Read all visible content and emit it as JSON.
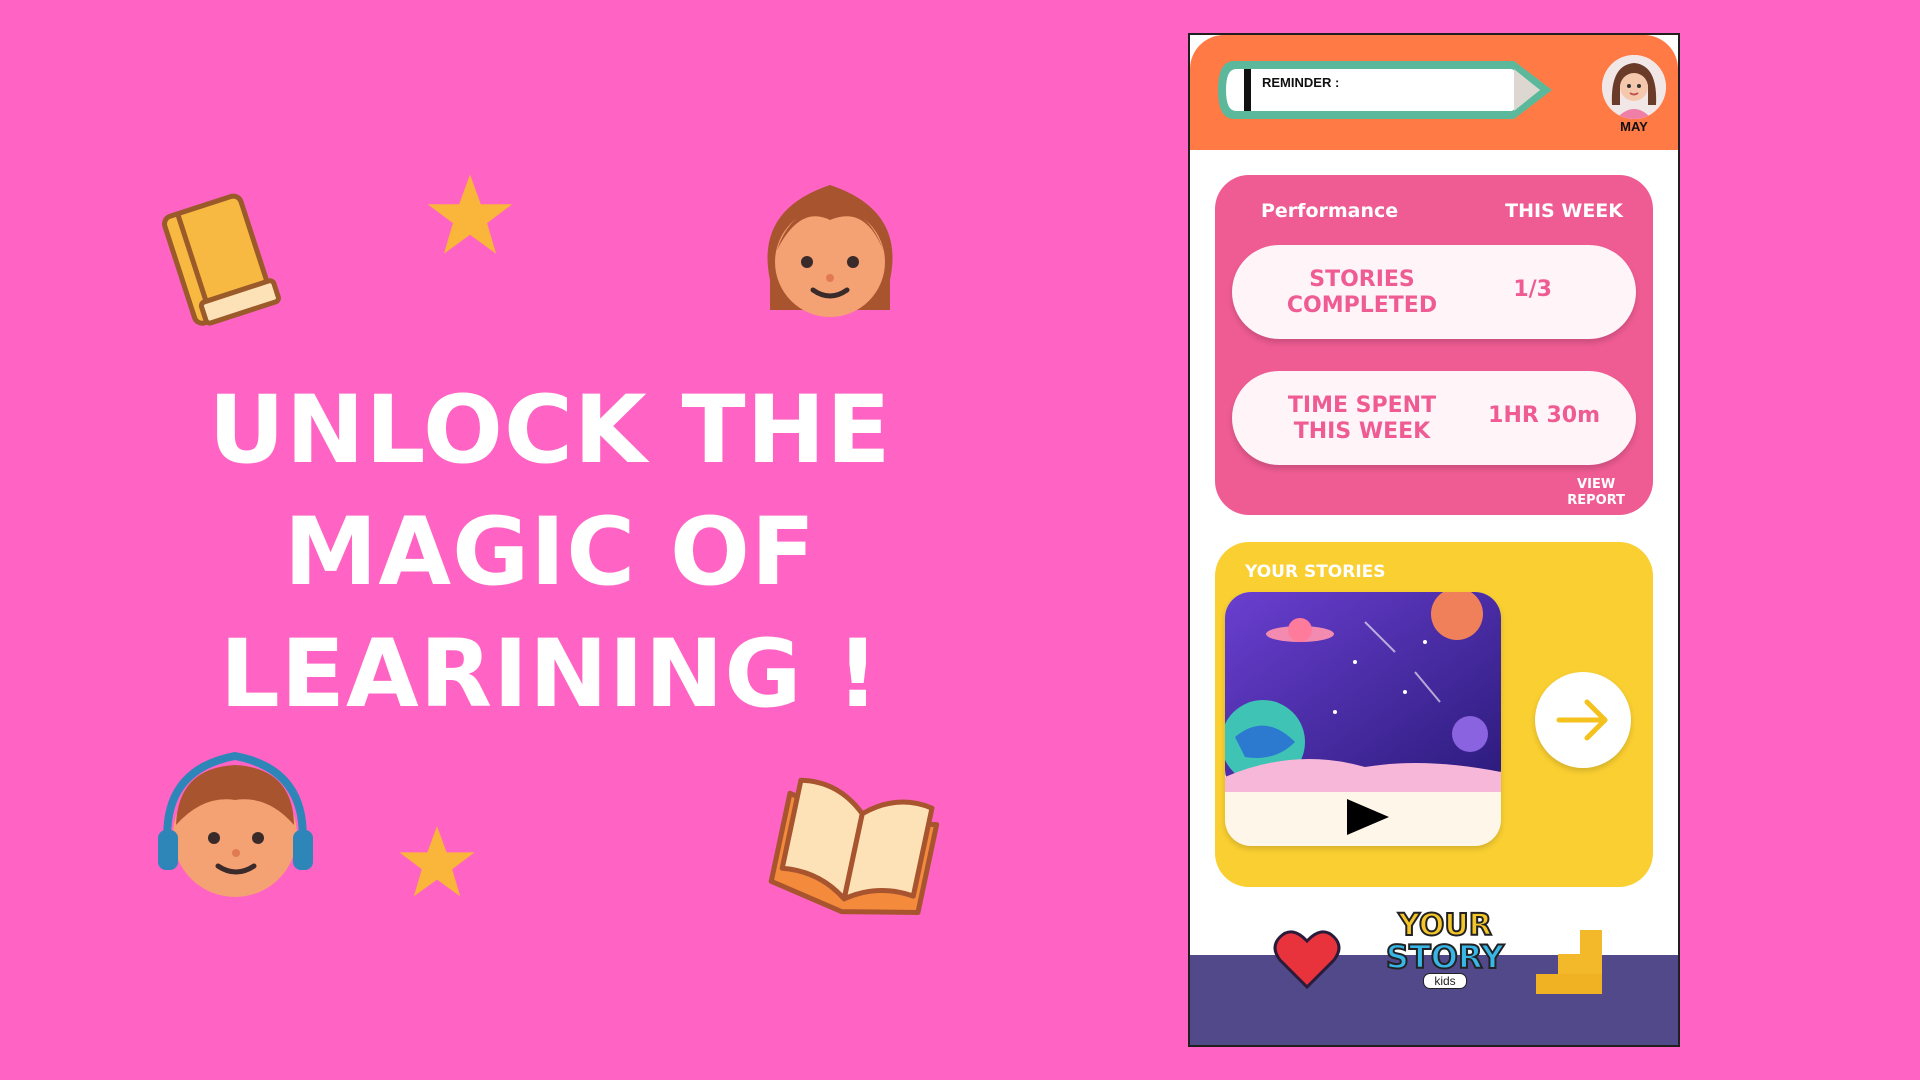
{
  "hero": {
    "line1": "UNLOCK THE",
    "line2": "MAGIC OF",
    "line3": "LEARINING !"
  },
  "header": {
    "reminder_label": "REMINDER :",
    "user_name": "MAY"
  },
  "performance": {
    "title": "Performance",
    "period": "THIS WEEK",
    "stats": [
      {
        "label_line1": "STORIES",
        "label_line2": "COMPLETED",
        "value": "1/3"
      },
      {
        "label_line1": "TIME SPENT",
        "label_line2": "THIS WEEK",
        "value": "1HR 30m"
      }
    ],
    "view_report_line1": "VIEW",
    "view_report_line2": "REPORT"
  },
  "stories": {
    "title": "YOUR STORIES"
  },
  "logo": {
    "line1": "YOUR",
    "line2": "STORY",
    "line3": "kids"
  },
  "icons": [
    "book-icon",
    "star-icon",
    "girl-face-icon",
    "boy-face-icon",
    "open-book-icon",
    "heart-icon",
    "play-icon",
    "arrow-right-icon",
    "bar-chart-icon",
    "pencil-icon"
  ],
  "colors": {
    "background": "#ff63c4",
    "header": "#ff7a45",
    "performance_card": "#ef5c93",
    "stories_card": "#f9cf31",
    "bottom_nav": "#52498a"
  }
}
